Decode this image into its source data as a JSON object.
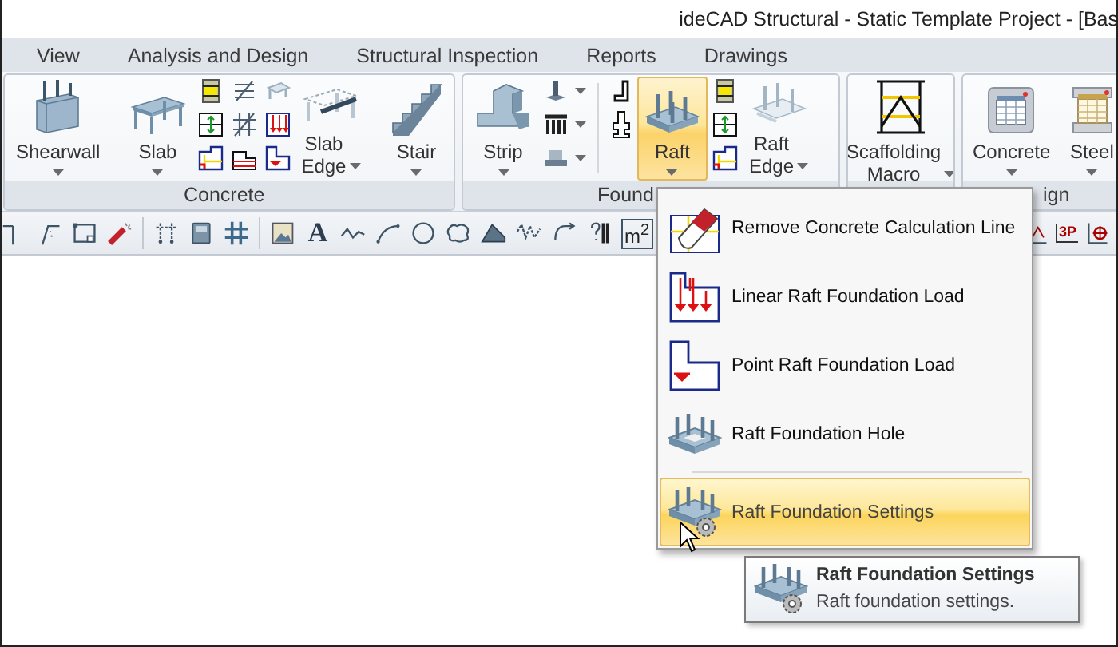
{
  "window": {
    "title": "ideCAD Structural - Static Template Project - [Bas"
  },
  "tabs": [
    {
      "label": "View",
      "selected": false
    },
    {
      "label": "Analysis and Design",
      "selected": false
    },
    {
      "label": "Structural Inspection",
      "selected": false
    },
    {
      "label": "Reports",
      "selected": false
    },
    {
      "label": "Drawings",
      "selected": false
    }
  ],
  "ribbon": {
    "groups": [
      {
        "label": "Concrete",
        "items": [
          {
            "kind": "large",
            "label": "Shearwall",
            "dropdown": true,
            "selected": false
          },
          {
            "kind": "separator"
          },
          {
            "kind": "large",
            "label": "Slab",
            "dropdown": true,
            "selected": false
          },
          {
            "kind": "icons"
          },
          {
            "kind": "large2",
            "label": "Slab Edge",
            "dropdown": true,
            "selected": false
          },
          {
            "kind": "separator"
          },
          {
            "kind": "large",
            "label": "Stair",
            "dropdown": true,
            "selected": false
          }
        ]
      },
      {
        "label": "Found",
        "items": [
          {
            "kind": "large",
            "label": "Strip",
            "dropdown": true,
            "selected": false
          },
          {
            "kind": "icons"
          },
          {
            "kind": "separator"
          },
          {
            "kind": "icons"
          },
          {
            "kind": "large",
            "label": "Raft",
            "dropdown": true,
            "selected": true
          },
          {
            "kind": "icons"
          },
          {
            "kind": "large2",
            "label": "Raft Edge",
            "dropdown": true,
            "selected": false
          }
        ]
      },
      {
        "items": [
          {
            "kind": "large2",
            "label": "Scaffolding Macro",
            "dropdown": true,
            "selected": false
          }
        ]
      },
      {
        "label": "ign",
        "items": [
          {
            "kind": "large",
            "label": "Concrete",
            "dropdown": true,
            "selected": false
          },
          {
            "kind": "large",
            "label": "Steel",
            "dropdown": true,
            "selected": false
          }
        ]
      }
    ]
  },
  "toolbar": {
    "text_glyph": "A",
    "area_glyph": "m$^{2}$",
    "point_glyph": "3P"
  },
  "menu": {
    "items": [
      {
        "label": "Remove Concrete Calculation Line",
        "highlighted": false
      },
      {
        "label": "Linear Raft Foundation Load",
        "highlighted": false
      },
      {
        "label": "Point Raft Foundation Load",
        "highlighted": false
      },
      {
        "label": "Raft Foundation Hole",
        "highlighted": false
      },
      {
        "label": "Raft Foundation Settings",
        "highlighted": true
      }
    ]
  },
  "tooltip": {
    "title": "Raft Foundation Settings",
    "description": "Raft foundation settings."
  }
}
